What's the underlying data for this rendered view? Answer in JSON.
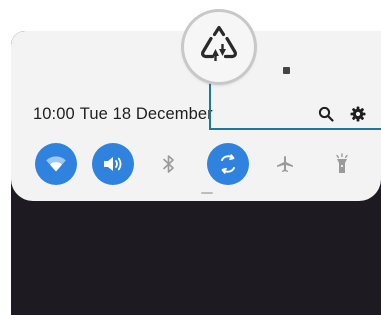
{
  "status_bar": {
    "icon": "status-indicator-icon"
  },
  "header": {
    "time": "10:00",
    "date": "Tue 18 December"
  },
  "actions": {
    "search_icon": "search-icon",
    "settings_icon": "gear-icon"
  },
  "quick_tiles": [
    {
      "name": "wifi",
      "icon": "wifi-icon",
      "state": "on"
    },
    {
      "name": "sound",
      "icon": "speaker-icon",
      "state": "on"
    },
    {
      "name": "bluetooth",
      "icon": "bluetooth-icon",
      "state": "off"
    },
    {
      "name": "auto-rotate",
      "icon": "rotate-icon",
      "state": "on"
    },
    {
      "name": "airplane-mode",
      "icon": "airplane-icon",
      "state": "off"
    },
    {
      "name": "flashlight",
      "icon": "flashlight-icon",
      "state": "off"
    }
  ],
  "highlight": {
    "icon": "data-saver-icon"
  },
  "colors": {
    "accent": "#2f82dd",
    "panel": "#f3f3f3",
    "background": "#1e1a22",
    "callout": "#1a78a0",
    "icon_off": "#9a9a9a"
  }
}
